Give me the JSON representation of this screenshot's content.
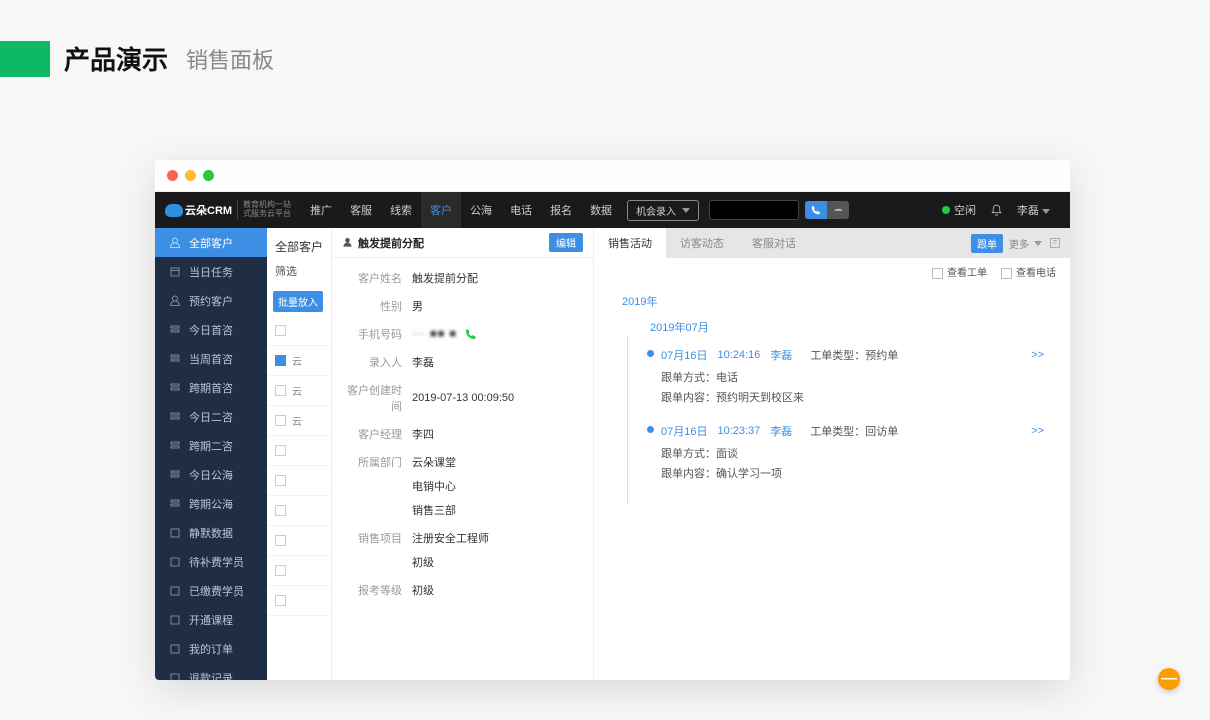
{
  "page_title": {
    "main": "产品演示",
    "sub": "销售面板"
  },
  "topnav": {
    "logo_text": "云朵CRM",
    "logo_sub1": "教育机构一站",
    "logo_sub2": "式服务云平台",
    "items": [
      "推广",
      "客服",
      "线索",
      "客户",
      "公海",
      "电话",
      "报名",
      "数据"
    ],
    "active_index": 3,
    "opportunity_btn": "机会录入",
    "status_text": "空闲",
    "user_name": "李磊"
  },
  "sidebar": {
    "items": [
      "全部客户",
      "当日任务",
      "预约客户",
      "今日首咨",
      "当周首咨",
      "跨期首咨",
      "今日二咨",
      "跨期二咨",
      "今日公海",
      "跨期公海",
      "静默数据",
      "待补费学员",
      "已缴费学员",
      "开通课程",
      "我的订单",
      "退款记录"
    ],
    "active_index": 0
  },
  "list": {
    "header": "全部客户",
    "filter_label": "筛选",
    "bulk_tag": "批量放入",
    "rows": [
      "",
      "云",
      "云",
      "云",
      "",
      "",
      "",
      "",
      "",
      ""
    ]
  },
  "detail": {
    "header_title": "触发提前分配",
    "edit_btn": "编辑",
    "fields": [
      {
        "label": "客户姓名",
        "value": "触发提前分配"
      },
      {
        "label": "性别",
        "value": "男"
      },
      {
        "label": "手机号码",
        "value": "··· ■■ ■",
        "phone": true
      },
      {
        "label": "录入人",
        "value": "李磊"
      },
      {
        "label": "客户创建时间",
        "value": "2019-07-13 00:09:50"
      },
      {
        "label": "客户经理",
        "value": "李四"
      },
      {
        "label": "所属部门",
        "values": [
          "云朵课堂",
          "电销中心",
          "销售三部"
        ]
      },
      {
        "label": "销售项目",
        "values": [
          "注册安全工程师",
          "初级"
        ]
      },
      {
        "label": "报考等级",
        "value": "初级"
      }
    ]
  },
  "activity": {
    "tabs": [
      "销售活动",
      "访客动态",
      "客服对话"
    ],
    "active_tab": 0,
    "badge": "跟单",
    "more": "更多",
    "check_workorder": "查看工单",
    "check_phone": "查看电话",
    "year": "2019年",
    "month": "2019年07月",
    "items": [
      {
        "date": "07月16日",
        "time": "10:24:16",
        "user": "李磊",
        "type_label": "工单类型：",
        "type_value": "预约单",
        "method_label": "跟单方式：",
        "method_value": "电话",
        "content_label": "跟单内容：",
        "content_value": "预约明天到校区来",
        "expand": ">>"
      },
      {
        "date": "07月16日",
        "time": "10:23:37",
        "user": "李磊",
        "type_label": "工单类型：",
        "type_value": "回访单",
        "method_label": "跟单方式：",
        "method_value": "面谈",
        "content_label": "跟单内容：",
        "content_value": "确认学习一项",
        "expand": ">>"
      }
    ]
  },
  "float_btn": "—"
}
